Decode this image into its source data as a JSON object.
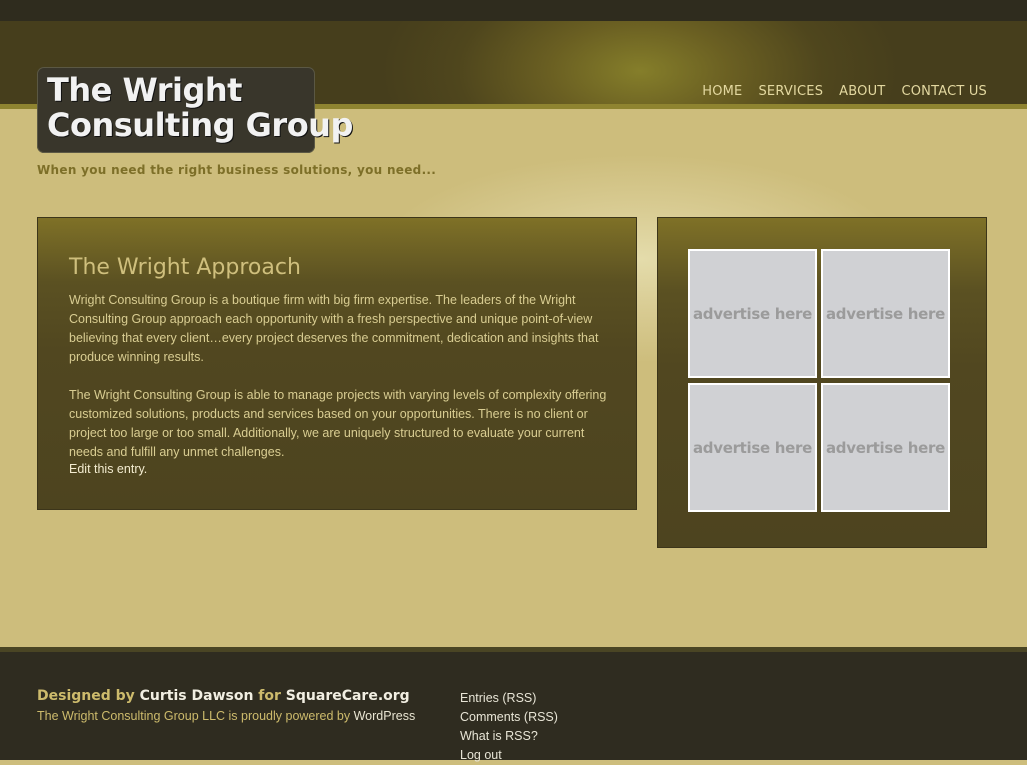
{
  "site": {
    "logo_line1": "The Wright",
    "logo_line2": "Consulting Group",
    "tagline": "When you need the right business solutions, you need..."
  },
  "nav": {
    "items": [
      {
        "label": "HOME"
      },
      {
        "label": "SERVICES"
      },
      {
        "label": "ABOUT"
      },
      {
        "label": "CONTACT US"
      }
    ]
  },
  "post": {
    "title": "The Wright Approach",
    "paragraphs": [
      "Wright Consulting Group is a boutique firm with big firm expertise. The leaders of the Wright Consulting Group approach each opportunity with a fresh perspective and unique point-of-view believing that every client…every project deserves the commitment, dedication and insights that produce winning results.",
      "The Wright Consulting Group is able to manage projects with varying levels of complexity offering customized solutions, products and services based on your opportunities. There is no client or project too large or too small. Additionally, we are uniquely structured to evaluate your current needs and fulfill any unmet challenges."
    ],
    "edit_link": "Edit this entry."
  },
  "sidebar": {
    "ads": [
      {
        "label": "advertise here"
      },
      {
        "label": "advertise here"
      },
      {
        "label": "advertise here"
      },
      {
        "label": "advertise here"
      }
    ]
  },
  "footer": {
    "designed_by_prefix": "Designed by",
    "designer": "Curtis Dawson",
    "for_word": "for",
    "site_link": "SquareCare.org",
    "powered_text": "The Wright Consulting Group LLC is proudly powered by",
    "powered_link": "WordPress",
    "links": [
      {
        "label": "Entries (RSS)"
      },
      {
        "label": "Comments (RSS)"
      },
      {
        "label": "What is RSS?"
      },
      {
        "label": "Log out"
      }
    ]
  },
  "colors": {
    "header_dark": "#463e1c",
    "content_tan": "#cdbd7c",
    "box_olive": "#514720",
    "footer_dark": "#2f2c20",
    "title_gold": "#cfbf7d"
  }
}
